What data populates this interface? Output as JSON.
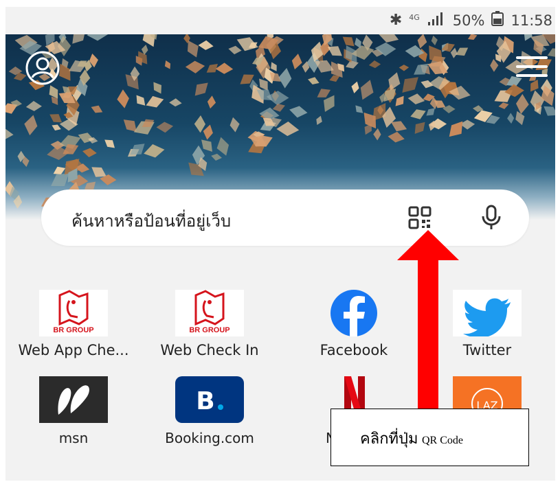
{
  "status_bar": {
    "bluetooth_icon": "bluetooth-icon",
    "network_type": "4G",
    "battery_percent": "50%",
    "time": "11:58"
  },
  "header": {
    "profile_icon": "profile-icon",
    "menu_icon": "hamburger-menu-icon"
  },
  "search": {
    "placeholder": "ค้นหาหรือป้อนที่อยู่เว็บ",
    "qr_icon": "qr-code-icon",
    "mic_icon": "microphone-icon"
  },
  "shortcuts": [
    {
      "label": "Web App Che...",
      "icon": "br-group-logo"
    },
    {
      "label": "Web Check In",
      "icon": "br-group-logo"
    },
    {
      "label": "Facebook",
      "icon": "facebook-logo"
    },
    {
      "label": "Twitter",
      "icon": "twitter-logo"
    },
    {
      "label": "msn",
      "icon": "msn-logo"
    },
    {
      "label": "Booking.com",
      "icon": "booking-logo"
    },
    {
      "label": "N",
      "icon": "netflix-logo"
    },
    {
      "label": "",
      "icon": "lazada-logo"
    }
  ],
  "logo_text": {
    "br_group": "BR GROUP",
    "booking_letter": "B",
    "lazada": "LAZ"
  },
  "annotation": {
    "text": "คลิกที่ปุ่ม",
    "text_small": "QR Code",
    "arrow_color": "#ff0000"
  },
  "colors": {
    "facebook": "#1877f2",
    "twitter": "#1d9bf0",
    "booking": "#003580",
    "netflix": "#e50914",
    "lazada": "#f57224",
    "br_red": "#d5141c"
  }
}
